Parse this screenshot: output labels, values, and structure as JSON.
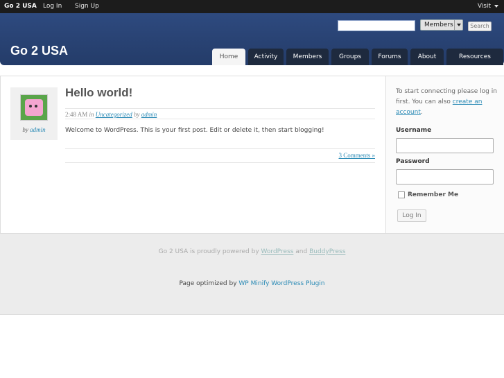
{
  "adminbar": {
    "brand": "Go 2 USA",
    "login": "Log In",
    "signup": "Sign Up",
    "visit": "Visit"
  },
  "header": {
    "site_title": "Go 2 USA",
    "search_select": "Members",
    "search_button": "Search"
  },
  "nav": {
    "tabs": [
      "Home",
      "Activity",
      "Members",
      "Groups",
      "Forums",
      "About",
      "Resources"
    ],
    "active": "Home"
  },
  "post": {
    "avatar_by_prefix": "by",
    "author": "admin",
    "title": "Hello world!",
    "time": "2:48 AM",
    "in_word": "in",
    "category": "Uncategorized",
    "by_word": "by",
    "meta_author": "admin",
    "body": "Welcome to WordPress. This is your first post. Edit or delete it, then start blogging!",
    "comments": "3 Comments »"
  },
  "sidebar": {
    "intro_text": "To start connecting please log in first. You can also",
    "create_link": "create an account",
    "intro_end": ".",
    "username_label": "Username",
    "password_label": "Password",
    "remember_label": "Remember Me",
    "login_button": "Log In"
  },
  "footer": {
    "powered_prefix": "Go 2 USA is proudly powered by",
    "wp_link": "WordPress",
    "and_word": "and",
    "bp_link": "BuddyPress",
    "optimized_prefix": "Page optimized by",
    "plugin_link": "WP Minify WordPress Plugin"
  },
  "colors": {
    "header_blue": "#2e4a7f",
    "tab_dark": "#1e2a3e",
    "link_blue": "#2a8ab5"
  }
}
